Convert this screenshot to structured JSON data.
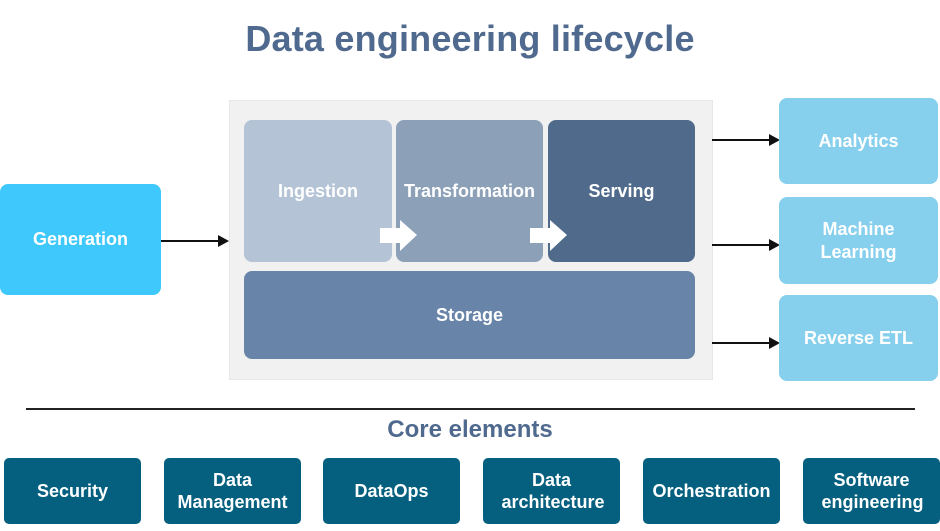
{
  "title": "Data engineering lifecycle",
  "source": {
    "label": "Generation",
    "color": "#3fc8fb"
  },
  "lifecycle": {
    "stages": [
      {
        "label": "Ingestion",
        "color": "#b4c3d5"
      },
      {
        "label": "Transformation",
        "color": "#8ca1b8"
      },
      {
        "label": "Serving",
        "color": "#4f6a8a"
      }
    ],
    "storage": {
      "label": "Storage",
      "color": "#6884a8"
    }
  },
  "outputs": [
    {
      "label": "Analytics"
    },
    {
      "label": "Machine Learning"
    },
    {
      "label": "Reverse ETL"
    }
  ],
  "outputs_color": "#86cfed",
  "core": {
    "title": "Core elements",
    "color": "#05607f",
    "items": [
      {
        "label": "Security"
      },
      {
        "label": "Data Management"
      },
      {
        "label": "DataOps"
      },
      {
        "label": "Data architecture"
      },
      {
        "label": "Orchestration"
      },
      {
        "label": "Software engineering"
      }
    ]
  }
}
